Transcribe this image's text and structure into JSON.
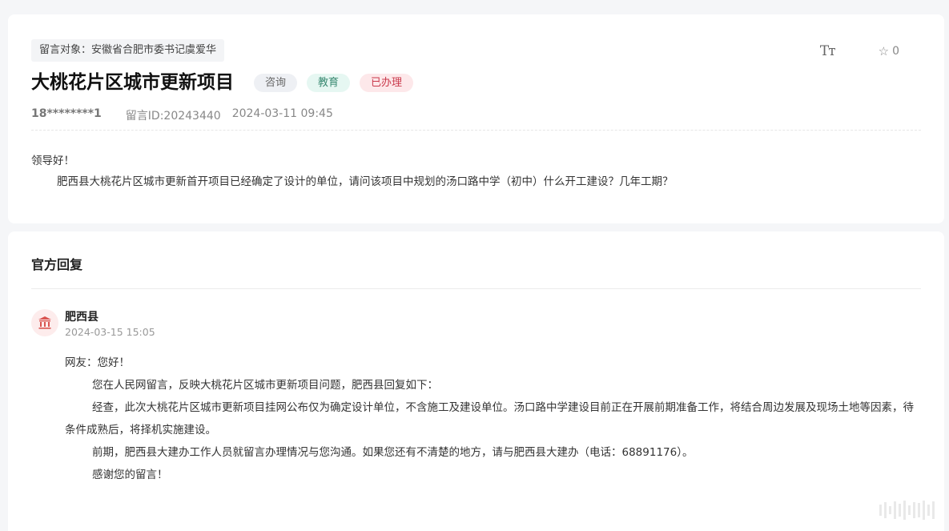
{
  "message": {
    "target": "留言对象：安徽省合肥市委书记虞爱华",
    "title": "大桃花片区城市更新项目",
    "tags": [
      "咨询",
      "教育",
      "已办理"
    ],
    "author": "18********1",
    "message_id": "留言ID:20243440",
    "datetime": "2024-03-11 09:45",
    "font_size_icon": "Tт",
    "star_count": "0",
    "greeting": "领导好！",
    "body": "肥西县大桃花片区城市更新首开项目已经确定了设计的单位，请问该项目中规划的汤口路中学（初中）什么开工建设？几年工期？"
  },
  "reply": {
    "heading": "官方回复",
    "org": "肥西县",
    "time": "2024-03-15 15:05",
    "salutation": "网友：您好！",
    "paragraphs": [
      "您在人民网留言，反映大桃花片区城市更新项目问题，肥西县回复如下：",
      "经查，此次大桃花片区城市更新项目挂网公布仅为确定设计单位，不含施工及建设单位。汤口路中学建设目前正在开展前期准备工作，将结合周边发展及现场土地等因素，待条件成熟后，将择机实施建设。",
      "前期，肥西县大建办工作人员就留言办理情况与您沟通。如果您还有不清楚的地方，请与肥西县大建办（电话：68891176）。",
      "感谢您的留言！"
    ]
  },
  "icons": {
    "font_size": "font-size-icon",
    "star": "star-icon",
    "org_avatar": "government-building-icon"
  },
  "colors": {
    "tag_consult_bg": "#eef0f4",
    "tag_edu_bg": "#e6f7f2",
    "tag_done_bg": "#fde8ea",
    "tag_done_text": "#c9394b"
  }
}
